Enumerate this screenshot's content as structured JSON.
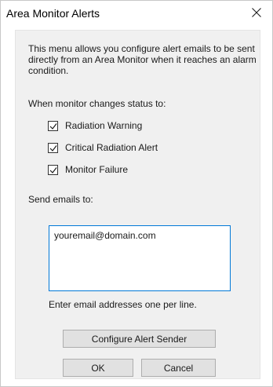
{
  "dialog": {
    "title": "Area Monitor Alerts",
    "close_icon": "close-icon"
  },
  "description": "This menu allows you configure alert emails to be sent directly from an Area Monitor when it reaches an alarm condition.",
  "status_section": {
    "label": "When monitor changes status to:",
    "options": [
      {
        "label": "Radiation Warning",
        "checked": true
      },
      {
        "label": "Critical Radiation Alert",
        "checked": true
      },
      {
        "label": "Monitor Failure",
        "checked": true
      }
    ]
  },
  "email_section": {
    "label": "Send emails to:",
    "value": "youremail@domain.com",
    "hint": "Enter email addresses one per line."
  },
  "buttons": {
    "configure": "Configure Alert Sender",
    "ok": "OK",
    "cancel": "Cancel"
  },
  "colors": {
    "focus_border": "#0078d7",
    "panel_background": "#f0f0f0",
    "button_background": "#e1e1e1"
  }
}
